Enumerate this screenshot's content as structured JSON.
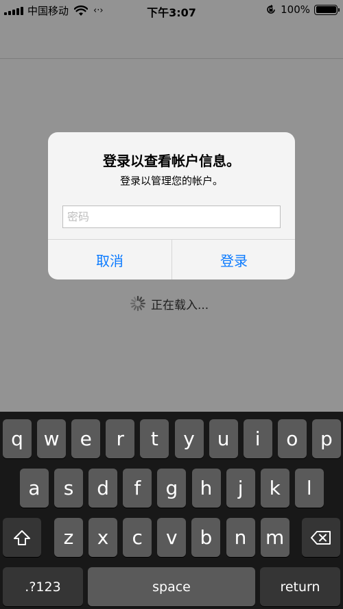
{
  "status_bar": {
    "carrier": "中国移动",
    "time": "下午3:07",
    "battery_percent": "100%",
    "battery_level": 1.0
  },
  "alert": {
    "title": "登录以查看帐户信息。",
    "message": "登录以管理您的帐户。",
    "password_placeholder": "密码",
    "password_value": "",
    "cancel_label": "取消",
    "login_label": "登录"
  },
  "loading": {
    "text": "正在载入..."
  },
  "keyboard": {
    "row1": [
      "q",
      "w",
      "e",
      "r",
      "t",
      "y",
      "u",
      "i",
      "o",
      "p"
    ],
    "row2": [
      "a",
      "s",
      "d",
      "f",
      "g",
      "h",
      "j",
      "k",
      "l"
    ],
    "row3": [
      "z",
      "x",
      "c",
      "v",
      "b",
      "n",
      "m"
    ],
    "shift_icon": "shift-icon",
    "delete_icon": "delete-icon",
    "numbers_label": ".?123",
    "space_label": "space",
    "return_label": "return"
  },
  "colors": {
    "accent": "#0a7aff",
    "dim_background": "#939393",
    "keyboard_background": "#181818",
    "key": "#5a5a5a",
    "key_dark": "#353535"
  }
}
